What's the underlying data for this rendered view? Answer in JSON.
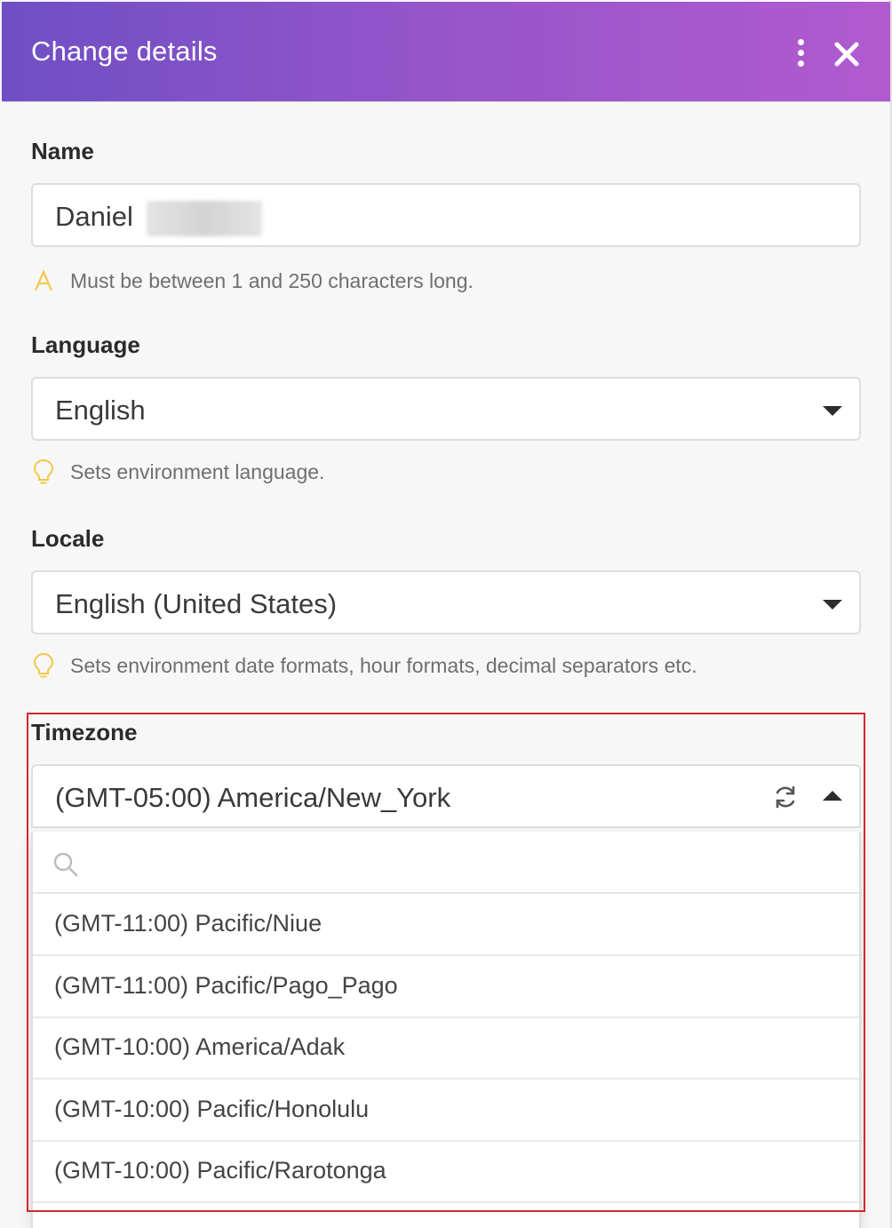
{
  "dialog": {
    "title": "Change details"
  },
  "name": {
    "label": "Name",
    "value": "Daniel",
    "hint": "Must be between 1 and 250 characters long."
  },
  "language": {
    "label": "Language",
    "value": "English",
    "hint": "Sets environment language."
  },
  "locale": {
    "label": "Locale",
    "value": "English (United States)",
    "hint": "Sets environment date formats, hour formats, decimal separators etc."
  },
  "timezone": {
    "label": "Timezone",
    "value": "(GMT-05:00) America/New_York",
    "search_placeholder": "",
    "options": [
      "(GMT-11:00) Pacific/Niue",
      "(GMT-11:00) Pacific/Pago_Pago",
      "(GMT-10:00) America/Adak",
      "(GMT-10:00) Pacific/Honolulu",
      "(GMT-10:00) Pacific/Rarotonga"
    ]
  },
  "colors": {
    "header_start": "#6f4fc4",
    "header_end": "#b15ad0",
    "warning": "#f2c84b",
    "highlight": "#d02929"
  },
  "icons": {
    "menu": "kebab-icon",
    "close": "close-icon",
    "warning": "warning-a-icon",
    "hint": "lightbulb-icon",
    "refresh": "refresh-icon",
    "search": "search-icon"
  }
}
